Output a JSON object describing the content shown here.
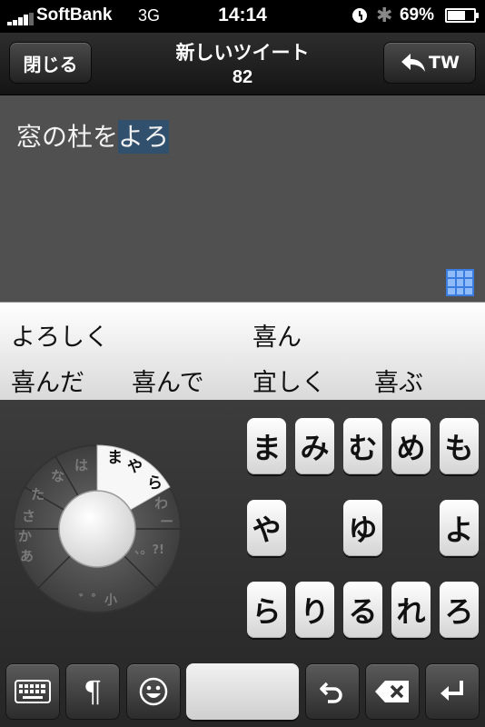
{
  "status": {
    "carrier": "SoftBank",
    "network": "3G",
    "time": "14:14",
    "battery": "69%",
    "battery_level": 0.69
  },
  "nav": {
    "close_label": "閉じる",
    "title": "新しいツイート",
    "count": "82",
    "tw_label": "TW"
  },
  "compose": {
    "committed": "窓の杜を",
    "composing": "よろ"
  },
  "candidates": [
    "よろしく",
    "喜ん",
    "喜んだ",
    "喜んで",
    "宜しく",
    "喜ぶ"
  ],
  "wheel": {
    "selected": {
      "ma": "ま",
      "ya": "や",
      "ra": "ら"
    },
    "labels": {
      "wa": "わ",
      "dash": "ー",
      "punct": "、。?!",
      "small": "゛゜小",
      "a": "あ",
      "ka": "か",
      "sa": "さ",
      "ta": "た",
      "na": "な",
      "ha": "は"
    }
  },
  "keys": {
    "row1": [
      "ま",
      "み",
      "む",
      "め",
      "も"
    ],
    "row2": [
      "や",
      "ゆ",
      "よ"
    ],
    "row3": [
      "ら",
      "り",
      "る",
      "れ",
      "ろ"
    ]
  },
  "bottom": {
    "pilcrow": "¶"
  }
}
